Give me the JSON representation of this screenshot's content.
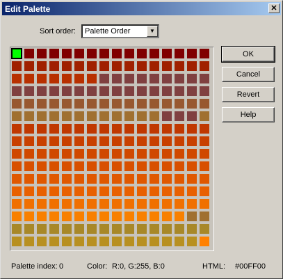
{
  "window": {
    "title": "Edit Palette",
    "close_glyph": "✕"
  },
  "sort": {
    "label": "Sort order:",
    "value": "Palette Order",
    "arrow": "▼"
  },
  "buttons": {
    "ok": "OK",
    "cancel": "Cancel",
    "revert": "Revert",
    "help": "Help"
  },
  "status": {
    "index_label": "Palette index:",
    "index_value": "0",
    "color_label": "Color:",
    "color_value": "R:0, G:255, B:0",
    "html_label": "HTML:",
    "html_value": "#00FF00"
  },
  "palette": {
    "selected_index": 0,
    "swatches": [
      "#00FF00",
      "#800000",
      "#800000",
      "#800000",
      "#800000",
      "#800000",
      "#800000",
      "#800000",
      "#800000",
      "#800000",
      "#800000",
      "#800000",
      "#800000",
      "#800000",
      "#800000",
      "#800000",
      "#A02000",
      "#A02000",
      "#A02000",
      "#A02000",
      "#A02000",
      "#A02000",
      "#A02000",
      "#A02000",
      "#A02000",
      "#A02000",
      "#A02000",
      "#A02000",
      "#A02000",
      "#A02000",
      "#A02000",
      "#A02000",
      "#B83000",
      "#B83000",
      "#B83000",
      "#B83000",
      "#B83000",
      "#B83000",
      "#B83000",
      "#804040",
      "#804040",
      "#804040",
      "#804040",
      "#804040",
      "#804040",
      "#804040",
      "#804040",
      "#804040",
      "#804040",
      "#804040",
      "#804040",
      "#804040",
      "#804040",
      "#804040",
      "#804040",
      "#804040",
      "#804040",
      "#804040",
      "#804040",
      "#804040",
      "#804040",
      "#804040",
      "#804040",
      "#804040",
      "#985830",
      "#985830",
      "#985830",
      "#985830",
      "#985830",
      "#985830",
      "#985830",
      "#985830",
      "#985830",
      "#985830",
      "#985830",
      "#985830",
      "#985830",
      "#985830",
      "#985830",
      "#985830",
      "#A07030",
      "#A07030",
      "#A07030",
      "#A07030",
      "#A07030",
      "#A07030",
      "#A07030",
      "#A07030",
      "#A07030",
      "#A07030",
      "#A07030",
      "#A07030",
      "#804040",
      "#804040",
      "#804040",
      "#A07030",
      "#C03800",
      "#C03800",
      "#C03800",
      "#C03800",
      "#C03800",
      "#C03800",
      "#C03800",
      "#C03800",
      "#C03800",
      "#C03800",
      "#C03800",
      "#C03800",
      "#C03800",
      "#C03800",
      "#C03800",
      "#C03800",
      "#C84000",
      "#C84000",
      "#C84000",
      "#C84000",
      "#C84000",
      "#C84000",
      "#C84000",
      "#C84000",
      "#C84000",
      "#C84000",
      "#C84000",
      "#C84000",
      "#C84000",
      "#C84000",
      "#C84000",
      "#C84000",
      "#D04800",
      "#D04800",
      "#D04800",
      "#D04800",
      "#D04800",
      "#D04800",
      "#D04800",
      "#D04800",
      "#D04800",
      "#D04800",
      "#D04800",
      "#D04800",
      "#D04800",
      "#D04800",
      "#D04800",
      "#D04800",
      "#D85000",
      "#D85000",
      "#D85000",
      "#D85000",
      "#D85000",
      "#D85000",
      "#D85000",
      "#D85000",
      "#D85000",
      "#D85000",
      "#D85000",
      "#D85000",
      "#D85000",
      "#D85000",
      "#D85000",
      "#D85000",
      "#E05800",
      "#E05800",
      "#E05800",
      "#E05800",
      "#E05800",
      "#E05800",
      "#E05800",
      "#E05800",
      "#E05800",
      "#E05800",
      "#E05800",
      "#E05800",
      "#E05800",
      "#E05800",
      "#E05800",
      "#E05800",
      "#E86000",
      "#E86000",
      "#E86000",
      "#E86000",
      "#E86000",
      "#E86000",
      "#E86000",
      "#E86000",
      "#E86000",
      "#E86000",
      "#E86000",
      "#E86000",
      "#E86000",
      "#E86000",
      "#E86000",
      "#E86000",
      "#F07000",
      "#F07000",
      "#F07000",
      "#F07000",
      "#F07000",
      "#F07000",
      "#F07000",
      "#F07000",
      "#F07000",
      "#F07000",
      "#F07000",
      "#F07000",
      "#F07000",
      "#F07000",
      "#F07000",
      "#F07000",
      "#F88000",
      "#F88000",
      "#F88000",
      "#F88000",
      "#F88000",
      "#F88000",
      "#F88000",
      "#F88000",
      "#F88000",
      "#F88000",
      "#F88000",
      "#F88000",
      "#F88000",
      "#F88000",
      "#A07030",
      "#A07030",
      "#A88828",
      "#A88828",
      "#A88828",
      "#A88828",
      "#A88828",
      "#A88828",
      "#A88828",
      "#A88828",
      "#A88828",
      "#A88828",
      "#A88828",
      "#A88828",
      "#A88828",
      "#A88828",
      "#A88828",
      "#A88828",
      "#B89020",
      "#B89020",
      "#B89020",
      "#B89020",
      "#B89020",
      "#B89020",
      "#B89020",
      "#B89020",
      "#B89020",
      "#B89020",
      "#B89020",
      "#B89020",
      "#B89020",
      "#B89020",
      "#B89020",
      "#FF8000"
    ]
  }
}
